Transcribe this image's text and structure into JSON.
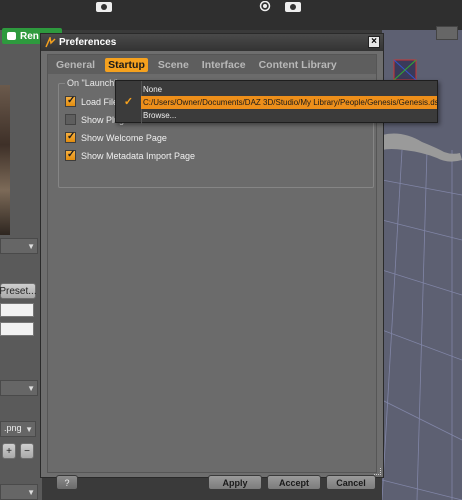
{
  "app": {
    "render_label": "Ren",
    "preset_label": "Preset...",
    "png_label": ".png",
    "plus_label": "+",
    "minus_label": "−",
    "accent_color": "#f5a11e",
    "render_color": "#2e9a3e"
  },
  "dialog": {
    "title": "Preferences",
    "close_glyph": "×",
    "tabs": [
      {
        "label": "General",
        "active": false
      },
      {
        "label": "Startup",
        "active": true
      },
      {
        "label": "Scene",
        "active": false
      },
      {
        "label": "Interface",
        "active": false
      },
      {
        "label": "Content Library",
        "active": false
      }
    ],
    "group_label": "On \"Launch\" :",
    "options": [
      {
        "label": "Load File :",
        "checked": true
      },
      {
        "label": "Show Plug-i",
        "checked": false
      },
      {
        "label": "Show Welcome Page",
        "checked": true
      },
      {
        "label": "Show Metadata Import Page",
        "checked": true
      }
    ],
    "popup_items": [
      {
        "label": "None",
        "selected": false
      },
      {
        "label": "C:/Users/Owner/Documents/DAZ 3D/Studio/My Library/People/Genesis/Genesis.dsf",
        "selected": true
      },
      {
        "label": "Browse...",
        "selected": false
      }
    ],
    "help_label": "?",
    "apply_label": "Apply",
    "accept_label": "Accept",
    "cancel_label": "Cancel"
  }
}
